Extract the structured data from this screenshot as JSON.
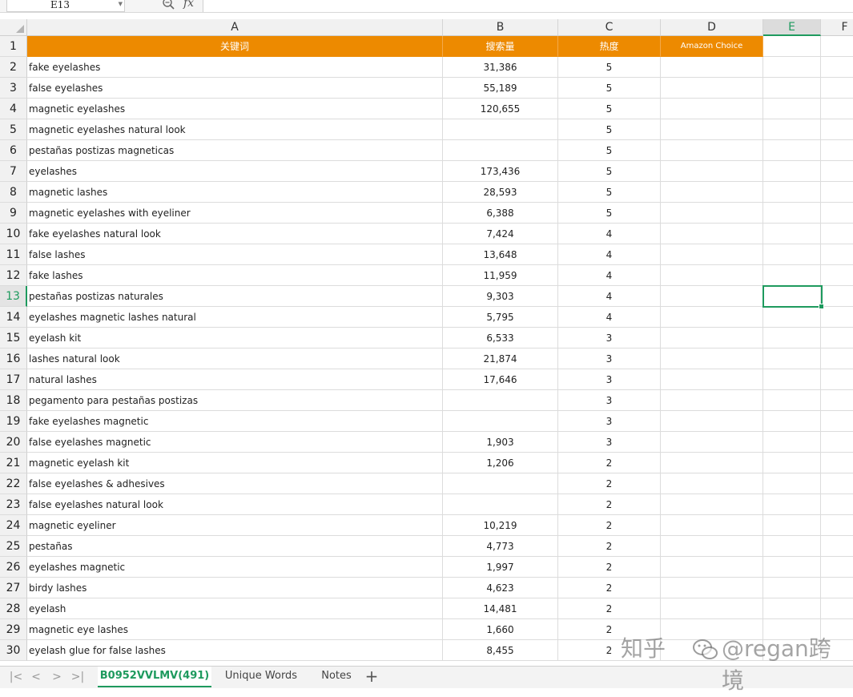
{
  "formula_bar": {
    "name_box": "E13",
    "fx_label": "fx",
    "formula_value": ""
  },
  "columns": [
    {
      "letter": "A",
      "active": false
    },
    {
      "letter": "B",
      "active": false
    },
    {
      "letter": "C",
      "active": false
    },
    {
      "letter": "D",
      "active": false
    },
    {
      "letter": "E",
      "active": true
    },
    {
      "letter": "F",
      "active": false
    }
  ],
  "header_row": {
    "row_number": "1",
    "keyword": "关键词",
    "search_volume": "搜索量",
    "heat": "热度",
    "amazon_choice": "Amazon Choice"
  },
  "rows": [
    {
      "n": "2",
      "keyword": "fake eyelashes",
      "volume": "31,386",
      "heat": "5"
    },
    {
      "n": "3",
      "keyword": "false eyelashes",
      "volume": "55,189",
      "heat": "5"
    },
    {
      "n": "4",
      "keyword": "magnetic eyelashes",
      "volume": "120,655",
      "heat": "5"
    },
    {
      "n": "5",
      "keyword": "magnetic eyelashes natural look",
      "volume": "",
      "heat": "5"
    },
    {
      "n": "6",
      "keyword": "pestañas postizas magneticas",
      "volume": "",
      "heat": "5"
    },
    {
      "n": "7",
      "keyword": "eyelashes",
      "volume": "173,436",
      "heat": "5"
    },
    {
      "n": "8",
      "keyword": "magnetic lashes",
      "volume": "28,593",
      "heat": "5"
    },
    {
      "n": "9",
      "keyword": "magnetic eyelashes with eyeliner",
      "volume": "6,388",
      "heat": "5"
    },
    {
      "n": "10",
      "keyword": "fake eyelashes natural look",
      "volume": "7,424",
      "heat": "4"
    },
    {
      "n": "11",
      "keyword": "false lashes",
      "volume": "13,648",
      "heat": "4"
    },
    {
      "n": "12",
      "keyword": "fake lashes",
      "volume": "11,959",
      "heat": "4"
    },
    {
      "n": "13",
      "keyword": "pestañas postizas naturales",
      "volume": "9,303",
      "heat": "4",
      "active": true
    },
    {
      "n": "14",
      "keyword": "eyelashes magnetic lashes natural",
      "volume": "5,795",
      "heat": "4"
    },
    {
      "n": "15",
      "keyword": "eyelash kit",
      "volume": "6,533",
      "heat": "3"
    },
    {
      "n": "16",
      "keyword": "lashes natural look",
      "volume": "21,874",
      "heat": "3"
    },
    {
      "n": "17",
      "keyword": "natural lashes",
      "volume": "17,646",
      "heat": "3"
    },
    {
      "n": "18",
      "keyword": "pegamento para pestañas postizas",
      "volume": "",
      "heat": "3"
    },
    {
      "n": "19",
      "keyword": "fake eyelashes magnetic",
      "volume": "",
      "heat": "3"
    },
    {
      "n": "20",
      "keyword": "false eyelashes magnetic",
      "volume": "1,903",
      "heat": "3"
    },
    {
      "n": "21",
      "keyword": "magnetic eyelash kit",
      "volume": "1,206",
      "heat": "2"
    },
    {
      "n": "22",
      "keyword": "false eyelashes & adhesives",
      "volume": "",
      "heat": "2"
    },
    {
      "n": "23",
      "keyword": "false eyelashes natural look",
      "volume": "",
      "heat": "2"
    },
    {
      "n": "24",
      "keyword": "magnetic eyeliner",
      "volume": "10,219",
      "heat": "2"
    },
    {
      "n": "25",
      "keyword": "pestañas",
      "volume": "4,773",
      "heat": "2"
    },
    {
      "n": "26",
      "keyword": "eyelashes magnetic",
      "volume": "1,997",
      "heat": "2"
    },
    {
      "n": "27",
      "keyword": "birdy lashes",
      "volume": "4,623",
      "heat": "2"
    },
    {
      "n": "28",
      "keyword": "eyelash",
      "volume": "14,481",
      "heat": "2"
    },
    {
      "n": "29",
      "keyword": "magnetic eye lashes",
      "volume": "1,660",
      "heat": "2"
    },
    {
      "n": "30",
      "keyword": "eyelash glue for false lashes",
      "volume": "8,455",
      "heat": "2"
    }
  ],
  "sheet_tabs": [
    {
      "label": "B0952VVLMV(491)",
      "active": true
    },
    {
      "label": "Unique Words",
      "active": false
    },
    {
      "label": "Notes",
      "active": false
    }
  ],
  "nav": {
    "first": "|<",
    "prev": "<",
    "next": ">",
    "last": ">|",
    "add": "+"
  },
  "watermark": {
    "site": "知乎",
    "account": "@regan跨境"
  },
  "colors": {
    "header_fill": "#ed8a00",
    "selection": "#1e9a5e"
  }
}
